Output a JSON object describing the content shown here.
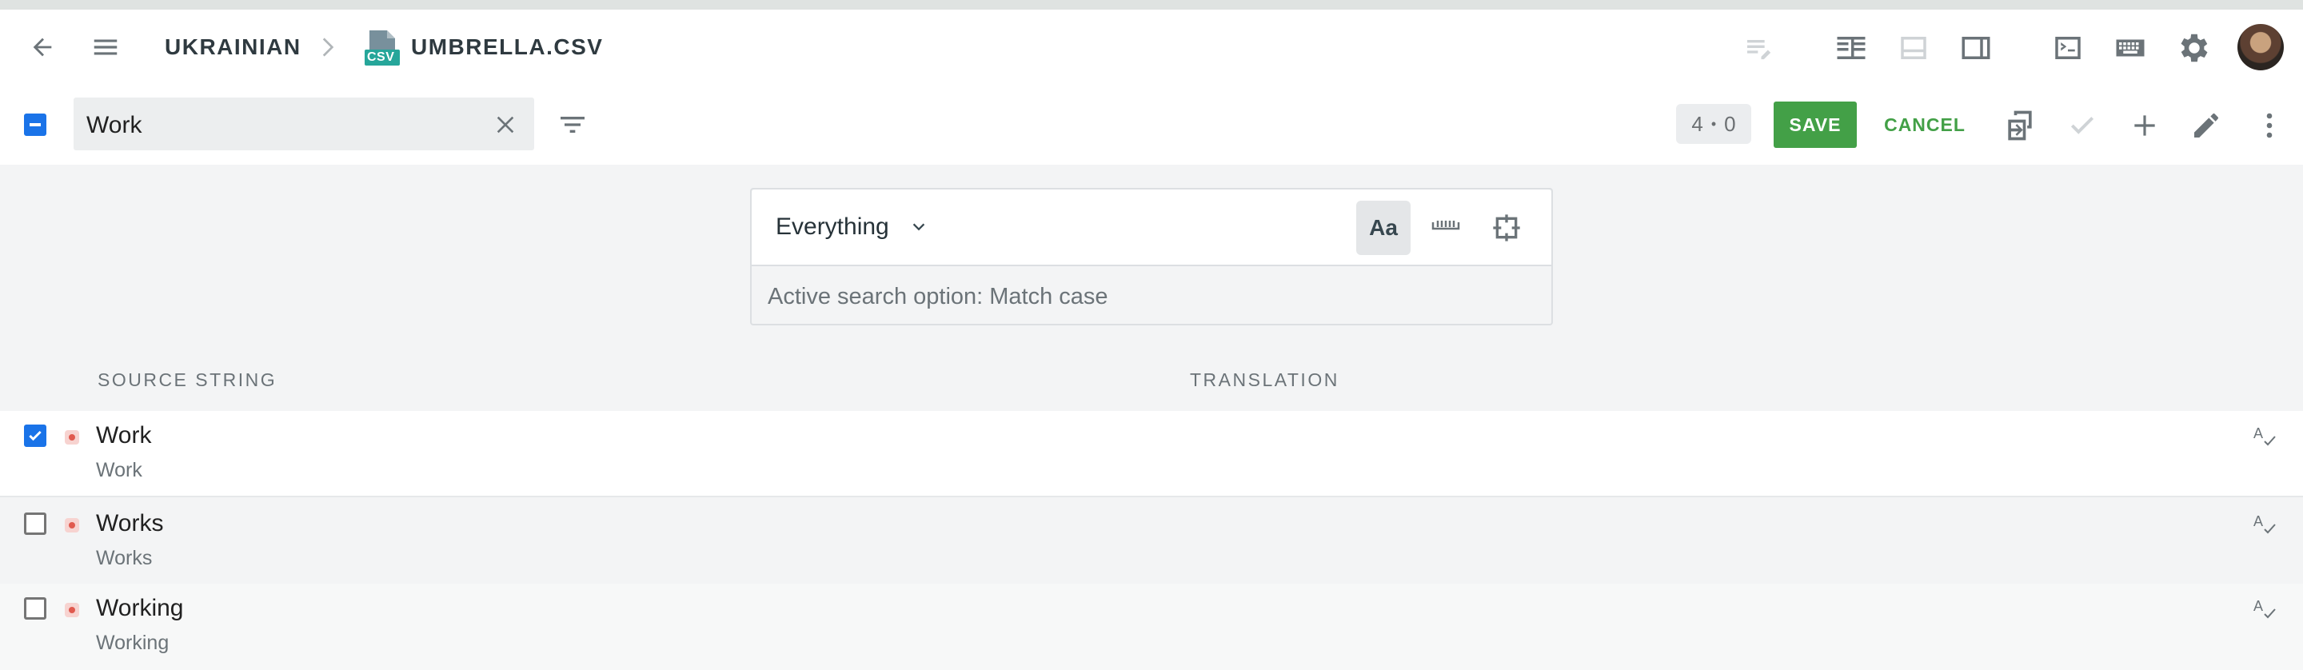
{
  "breadcrumb": {
    "language": "UKRAINIAN",
    "file_badge": "CSV",
    "file_name": "UMBRELLA.CSV"
  },
  "colors": {
    "accent_green": "#43a047",
    "accent_blue": "#1a73e8",
    "status_red": "#e05a4f"
  },
  "toolbar": {
    "search_value": "Work",
    "counter_left": "4",
    "counter_sep": "•",
    "counter_right": "0",
    "save_label": "SAVE",
    "cancel_label": "CANCEL"
  },
  "search_options": {
    "scope_selected": "Everything",
    "case_toggle_label": "Aa",
    "hint": "Active search option: Match case"
  },
  "columns": {
    "source": "SOURCE STRING",
    "translation": "TRANSLATION"
  },
  "rows": [
    {
      "source": "Work",
      "context": "Work",
      "checked": true
    },
    {
      "source": "Works",
      "context": "Works",
      "checked": false
    },
    {
      "source": "Working",
      "context": "Working",
      "checked": false
    }
  ]
}
